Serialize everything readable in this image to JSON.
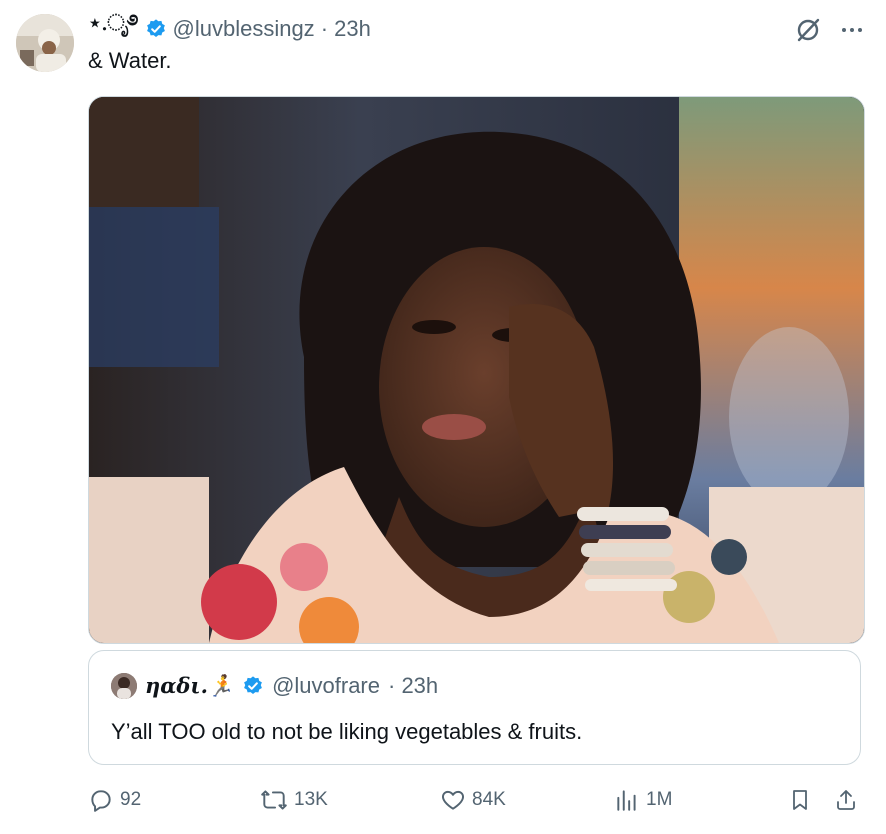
{
  "tweet": {
    "display_name": "⋆.ೃ࿔",
    "handle": "@luvblessingz",
    "time": "· 23h",
    "text": "& Water."
  },
  "media": {
    "alt": "meme photo"
  },
  "quote": {
    "display_name": "ηαδι.🏃",
    "handle": "@luvofrare",
    "time": "· 23h",
    "text": "Y’all TOO old to not be liking vegetables & fruits."
  },
  "actions": {
    "replies": "92",
    "reposts": "13K",
    "likes": "84K",
    "views": "1M"
  },
  "colors": {
    "accent": "#1d9bf0",
    "muted": "#536471",
    "text": "#0f1419",
    "border": "#cfd9de"
  },
  "icons": [
    "verified-icon",
    "grok-icon",
    "more-icon",
    "reply-icon",
    "repost-icon",
    "like-icon",
    "views-icon",
    "bookmark-icon",
    "share-icon"
  ]
}
